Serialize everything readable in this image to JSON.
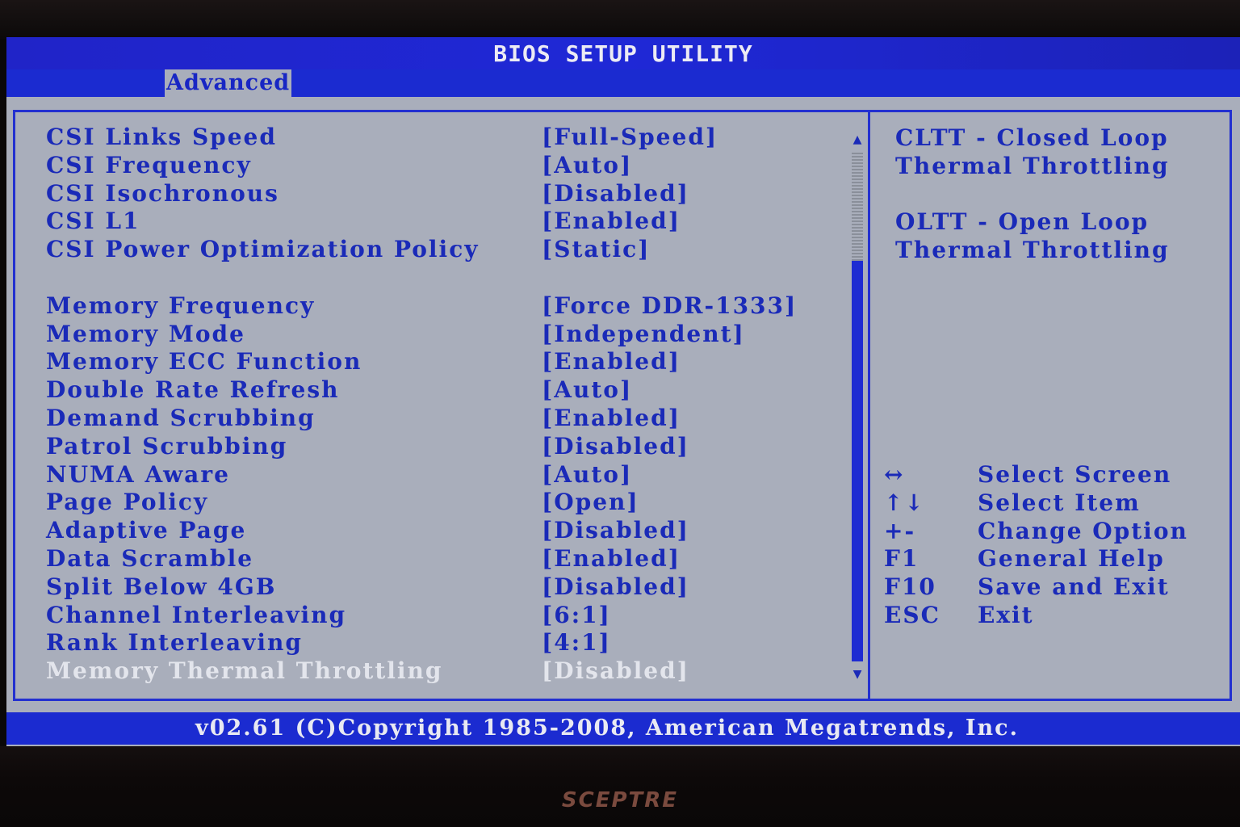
{
  "title": "BIOS SETUP UTILITY",
  "menu": {
    "active_tab": "Advanced"
  },
  "settings": [
    {
      "label": "CSI Links Speed",
      "value": "[Full-Speed]"
    },
    {
      "label": "CSI Frequency",
      "value": "[Auto]"
    },
    {
      "label": "CSI Isochronous",
      "value": "[Disabled]"
    },
    {
      "label": "CSI L1",
      "value": "[Enabled]"
    },
    {
      "label": "CSI Power Optimization Policy",
      "value": "[Static]"
    },
    {
      "label": "Memory Frequency",
      "value": "[Force DDR-1333]"
    },
    {
      "label": "Memory Mode",
      "value": "[Independent]"
    },
    {
      "label": "Memory ECC Function",
      "value": "[Enabled]"
    },
    {
      "label": "Double Rate Refresh",
      "value": "[Auto]"
    },
    {
      "label": "Demand Scrubbing",
      "value": "[Enabled]"
    },
    {
      "label": "Patrol Scrubbing",
      "value": "[Disabled]"
    },
    {
      "label": "NUMA Aware",
      "value": "[Auto]"
    },
    {
      "label": "Page Policy",
      "value": "[Open]"
    },
    {
      "label": "Adaptive Page",
      "value": "[Disabled]"
    },
    {
      "label": "Data Scramble",
      "value": "[Enabled]"
    },
    {
      "label": "Split Below 4GB",
      "value": "[Disabled]"
    },
    {
      "label": "Channel Interleaving",
      "value": "[6:1]"
    },
    {
      "label": "Rank Interleaving",
      "value": "[4:1]"
    },
    {
      "label": "Memory Thermal Throttling",
      "value": "[Disabled]"
    }
  ],
  "selected_item": "Memory Thermal Throttling",
  "scroll": {
    "up_arrow": "▲",
    "down_arrow": "▼"
  },
  "help": {
    "line1": "CLTT - Closed Loop",
    "line2": "Thermal Throttling",
    "line3": "OLTT - Open Loop",
    "line4": "Thermal Throttling"
  },
  "keys": [
    {
      "key": "↔",
      "desc": "Select Screen"
    },
    {
      "key": "↑↓",
      "desc": "Select Item"
    },
    {
      "key": "+-",
      "desc": "Change Option"
    },
    {
      "key": "F1",
      "desc": "General Help"
    },
    {
      "key": "F10",
      "desc": "Save and Exit"
    },
    {
      "key": "ESC",
      "desc": "Exit"
    }
  ],
  "footer": "v02.61 (C)Copyright 1985-2008, American Megatrends, Inc.",
  "monitor_brand": "SCEPTRE",
  "colors": {
    "bios_blue": "#1b2bd0",
    "background_gray": "#a9aebb",
    "text_blue": "#1a2ab8",
    "highlight_text": "#e3e5ec"
  }
}
